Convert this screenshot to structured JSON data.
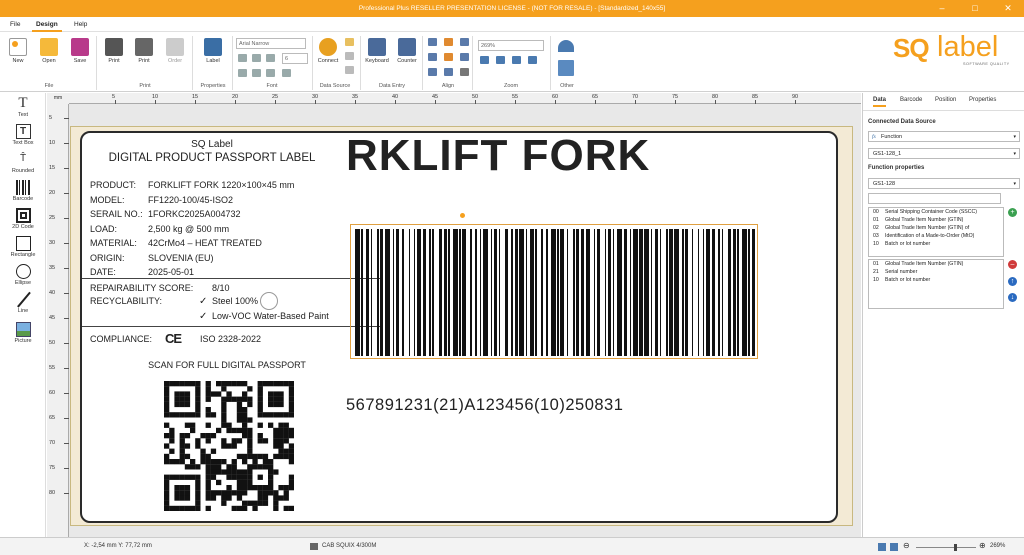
{
  "window": {
    "title": "Professional Plus RESELLER PRESENTATION LICENSE - (NOT FOR RESALE) - [Standardized_140x55]"
  },
  "menu": {
    "file": "File",
    "design": "Design",
    "help": "Help"
  },
  "ribbon": {
    "new": "New",
    "open": "Open",
    "save": "Save",
    "print": "Print",
    "print2": "Print",
    "order": "Order",
    "label": "Label",
    "connect": "Connect",
    "keyboard": "Keyboard",
    "counter": "Counter",
    "font_name": "Arial Narrow",
    "font_size": "6",
    "zoom": "269%",
    "groups": {
      "file": "File",
      "print": "Print",
      "properties": "Properties",
      "font": "Font",
      "data_source": "Data Source",
      "data_entry": "Data Entry",
      "align": "Align",
      "zoom": "Zoom",
      "other": "Other"
    }
  },
  "logo": {
    "sq": "SQ",
    "label": "label",
    "tagline": "SOFTWARE QUALITY"
  },
  "tools": [
    "Text",
    "Text Box",
    "Rounded",
    "Barcode",
    "2D Code",
    "Rectangle",
    "Ellipse",
    "Line",
    "Picture"
  ],
  "ruler": {
    "unit": "mm",
    "h": [
      "5",
      "10",
      "15",
      "20",
      "25",
      "30",
      "35",
      "40",
      "45",
      "50",
      "55",
      "60",
      "65",
      "70",
      "75",
      "80",
      "85",
      "90"
    ],
    "v": [
      "5",
      "10",
      "15",
      "20",
      "25",
      "30",
      "35",
      "40",
      "45",
      "50",
      "55",
      "60",
      "65",
      "70",
      "75",
      "80"
    ]
  },
  "labelcontent": {
    "brand": "SQ Label",
    "title": "DIGITAL PRODUCT PASSPORT LABEL",
    "fields": [
      {
        "k": "PRODUCT:",
        "v": "FORKLIFT FORK 1220×100×45 mm"
      },
      {
        "k": "MODEL:",
        "v": "FF1220-100/45-ISO2"
      },
      {
        "k": "SERAIL NO.:",
        "v": "1FORKC2025A004732"
      },
      {
        "k": "LOAD:",
        "v": "2,500 kg @ 500 mm"
      },
      {
        "k": "MATERIAL:",
        "v": "42CrMo4 – HEAT TREATED"
      },
      {
        "k": "ORIGIN:",
        "v": "SLOVENIA (EU)"
      },
      {
        "k": "DATE:",
        "v": "2025-05-01"
      }
    ],
    "repair_k": "REPAIRABILITY SCORE:",
    "repair_v": "8/10",
    "recycle_k": "RECYCLABILITY:",
    "recycle_1": "Steel 100%",
    "recycle_2": "Low-VOC Water-Based Paint",
    "check": "✓",
    "compliance_k": "COMPLIANCE:",
    "ce": "CE",
    "compliance_v": "ISO 2328-2022",
    "scan": "SCAN FOR FULL DIGITAL PASSPORT",
    "bigtext": "RKLIFT FORK",
    "barcode_text": "567891231(21)A123456(10)250831"
  },
  "panel": {
    "tabs": [
      "Data",
      "Barcode",
      "Position",
      "Properties"
    ],
    "connected": "Connected Data Source",
    "function": "Function",
    "gs1": "GS1-128_1",
    "fnprops": "Function properties",
    "gs1b": "GS1-128",
    "ai_list": [
      {
        "c": "00",
        "t": "Serial Shipping Container Code (SSCC)"
      },
      {
        "c": "01",
        "t": "Global Trade Item Number (GTIN)"
      },
      {
        "c": "02",
        "t": "Global Trade Item Number (GTIN) of"
      },
      {
        "c": "03",
        "t": "Identification of a Made-to-Order (MtO)"
      },
      {
        "c": "10",
        "t": "Batch or lot number"
      }
    ],
    "sel_list": [
      {
        "c": "01",
        "t": "Global Trade Item Number (GTIN)"
      },
      {
        "c": "21",
        "t": "Serial number"
      },
      {
        "c": "10",
        "t": "Batch or lot number"
      }
    ]
  },
  "status": {
    "coords": "X: -2,54 mm Y: 77,72 mm",
    "printer": "CAB SQUIX 4/300M",
    "zoom": "269%"
  }
}
